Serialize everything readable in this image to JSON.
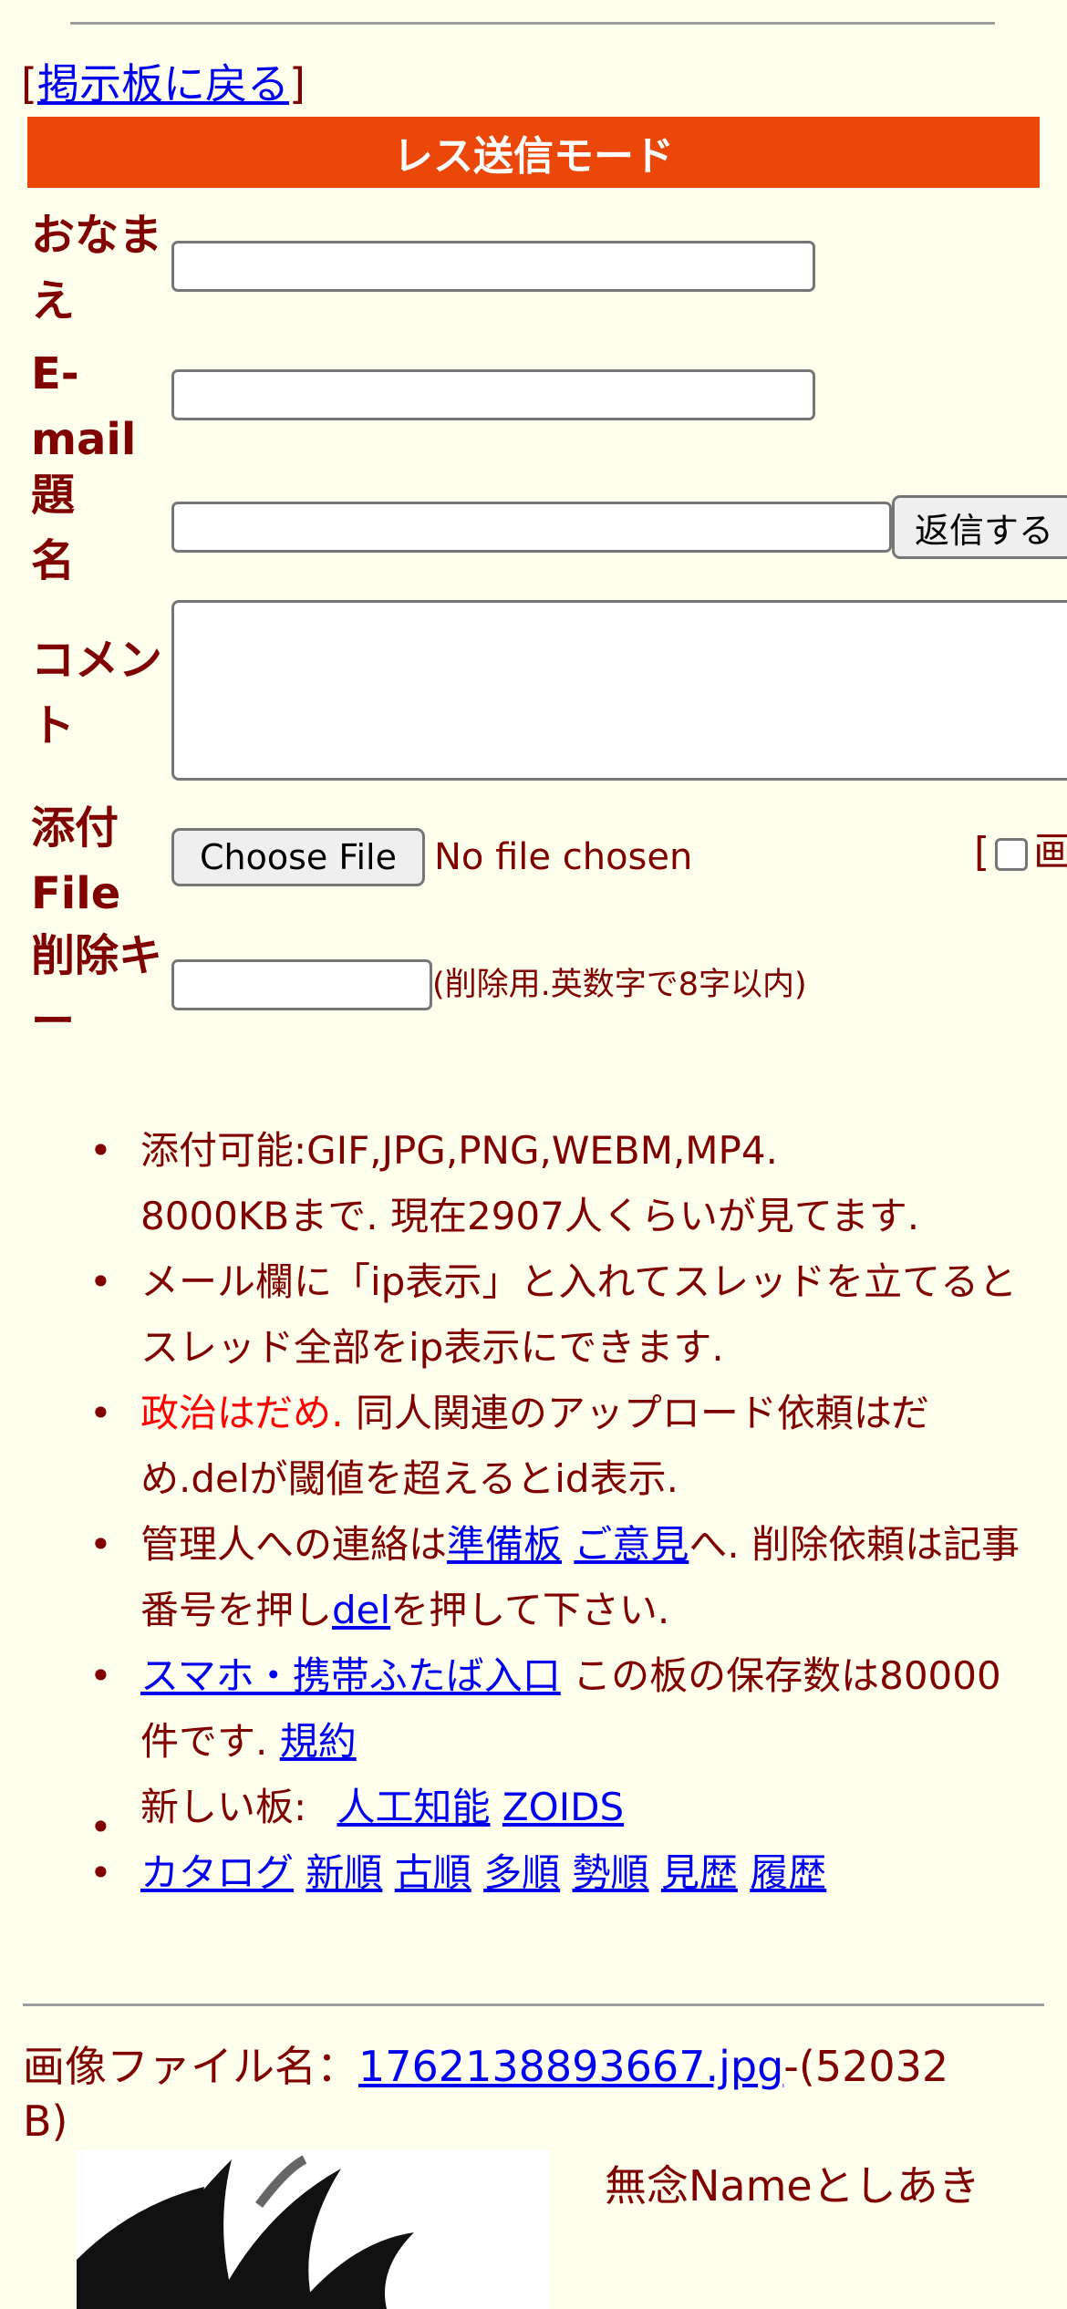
{
  "back_prefix": "[",
  "back_link": "掲示板に戻る",
  "back_suffix": "]",
  "banner_title": "レス送信モード",
  "form": {
    "name_label_1": "おなま",
    "name_label_2": "え",
    "email_label_1": "E-",
    "email_label_2": "mail",
    "subject_label_1": "題",
    "subject_label_2": "名",
    "submit_label": "返信する",
    "comment_label_1": "コメン",
    "comment_label_2": "ト",
    "file_label_1": "添付",
    "file_label_2": "File",
    "choose_file_label": "Choose File",
    "no_file_label": "No file chosen",
    "image_option_prefix": "[",
    "image_option_label": "画",
    "delkey_label_1": "削除キ",
    "delkey_label_2": "ー",
    "delkey_hint": "(削除用.英数字で8字以内)"
  },
  "rules": {
    "r1_line1": "添付可能:GIF,JPG,PNG,WEBM,MP4.",
    "r1_line2": "8000KBまで. 現在2907人くらいが見てます.",
    "r2": "メール欄に「ip表示」と入れてスレッドを立てるとスレッド全部をip表示にできます.",
    "r3_red": "政治はだめ.",
    "r3_rest": " 同人関連のアップロード依頼はだめ.delが閾値を超えるとid表示.",
    "r4_pre": "管理人への連絡は",
    "r4_link1": "準備板",
    "r4_link2": "ご意見",
    "r4_mid": "へ. 削除依頼は記事番号を押し",
    "r4_link3": "del",
    "r4_post": "を押して下さい.",
    "r5_link": "スマホ・携帯ふたば入口",
    "r5_text": " この板の保存数は80000件です. ",
    "r5_link2": "規約",
    "new_boards_label": "新しい板: ",
    "new_board_1": "人工知能",
    "new_board_2": "ZOIDS",
    "nav": [
      "カタログ",
      "新順",
      "古順",
      "多順",
      "勢順",
      "見歴",
      "履歴"
    ]
  },
  "post": {
    "file_prefix": "画像ファイル名：",
    "file_name": "1762138893667.jpg",
    "file_size_line1": "-(52032",
    "file_size_line2": "B)",
    "poster_name": "無念Nameとしあき"
  }
}
